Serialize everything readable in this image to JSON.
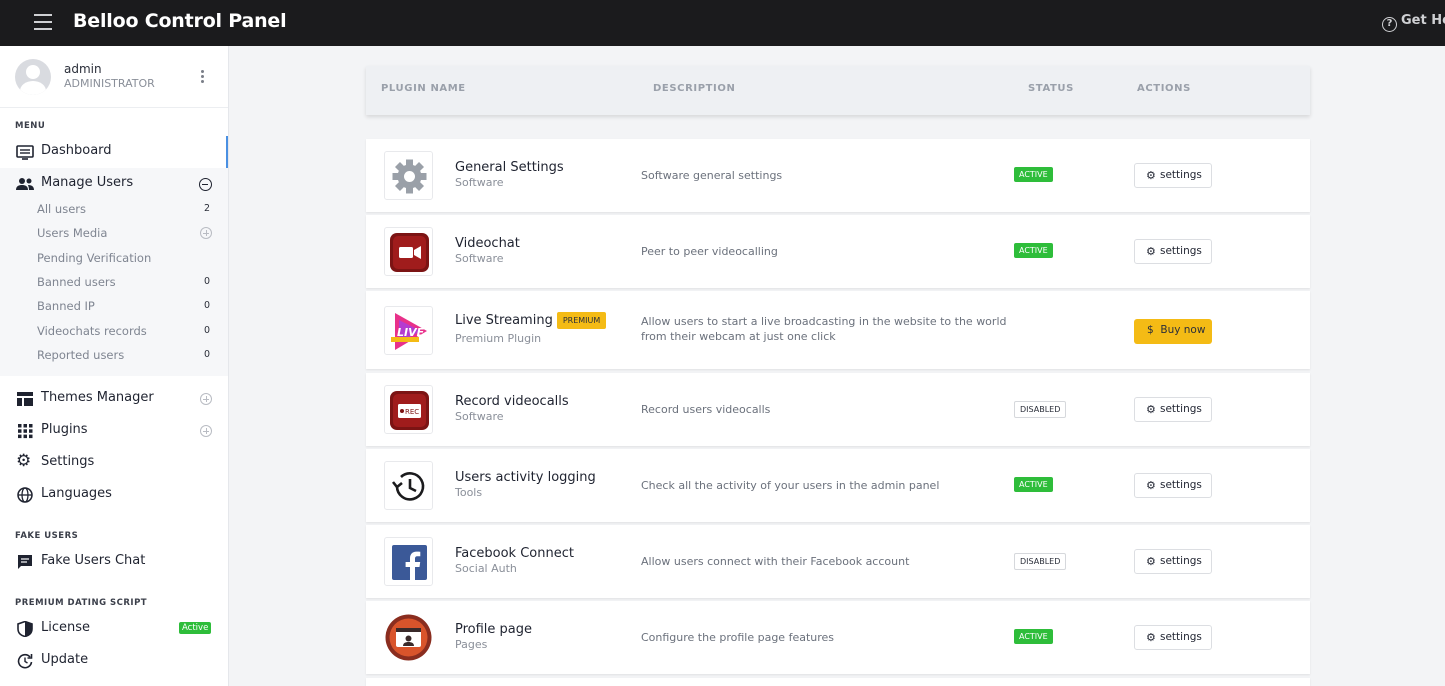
{
  "app": {
    "title": "Belloo Control Panel",
    "help_label": "Get He"
  },
  "user": {
    "name": "admin",
    "role": "ADMINISTRATOR"
  },
  "sidebar": {
    "menu_label": "MENU",
    "dashboard": "Dashboard",
    "manage_users": "Manage Users",
    "sub_items": [
      {
        "label": "All users",
        "count": "2"
      },
      {
        "label": "Users Media",
        "count": ""
      },
      {
        "label": "Pending Verification",
        "count": ""
      },
      {
        "label": "Banned users",
        "count": "0"
      },
      {
        "label": "Banned IP",
        "count": "0"
      },
      {
        "label": "Videochats records",
        "count": "0"
      },
      {
        "label": "Reported users",
        "count": "0"
      }
    ],
    "themes_manager": "Themes Manager",
    "plugins": "Plugins",
    "settings": "Settings",
    "languages": "Languages",
    "fake_users_label": "FAKE USERS",
    "fake_users_chat": "Fake Users Chat",
    "premium_label": "PREMIUM DATING SCRIPT",
    "license": "License",
    "license_badge": "Active",
    "update": "Update"
  },
  "table": {
    "headers": {
      "name": "PLUGIN NAME",
      "description": "DESCRIPTION",
      "status": "STATUS",
      "actions": "ACTIONS"
    },
    "rows": [
      {
        "name": "General Settings",
        "category": "Software",
        "description": "Software general settings",
        "status": "ACTIVE",
        "action": "settings",
        "icon": "gear-icon"
      },
      {
        "name": "Videochat",
        "category": "Software",
        "description": "Peer to peer videocalling",
        "status": "ACTIVE",
        "action": "settings",
        "icon": "videochat-icon"
      },
      {
        "name": "Live Streaming",
        "premium": "PREMIUM",
        "category": "Premium Plugin",
        "description": "Allow users to start a live broadcasting in the website to the world from their webcam at just one click",
        "status": "",
        "action": "Buy now",
        "icon": "live-streaming-icon"
      },
      {
        "name": "Record videocalls",
        "category": "Software",
        "description": "Record users videocalls",
        "status": "DISABLED",
        "action": "settings",
        "icon": "record-icon",
        "rec_text": "REC"
      },
      {
        "name": "Users activity logging",
        "category": "Tools",
        "description": "Check all the activity of your users in the admin panel",
        "status": "ACTIVE",
        "action": "settings",
        "icon": "history-icon"
      },
      {
        "name": "Facebook Connect",
        "category": "Social Auth",
        "description": "Allow users connect with their Facebook account",
        "status": "DISABLED",
        "action": "settings",
        "icon": "facebook-icon"
      },
      {
        "name": "Profile page",
        "category": "Pages",
        "description": "Configure the profile page features",
        "status": "ACTIVE",
        "action": "settings",
        "icon": "profile-page-icon"
      }
    ],
    "live_text": "LIVE"
  },
  "colors": {
    "topbar": "#1b1b1d",
    "active_green": "#2ebd3a",
    "premium_yellow": "#f4bb15",
    "accent_blue": "#4a90e2"
  }
}
